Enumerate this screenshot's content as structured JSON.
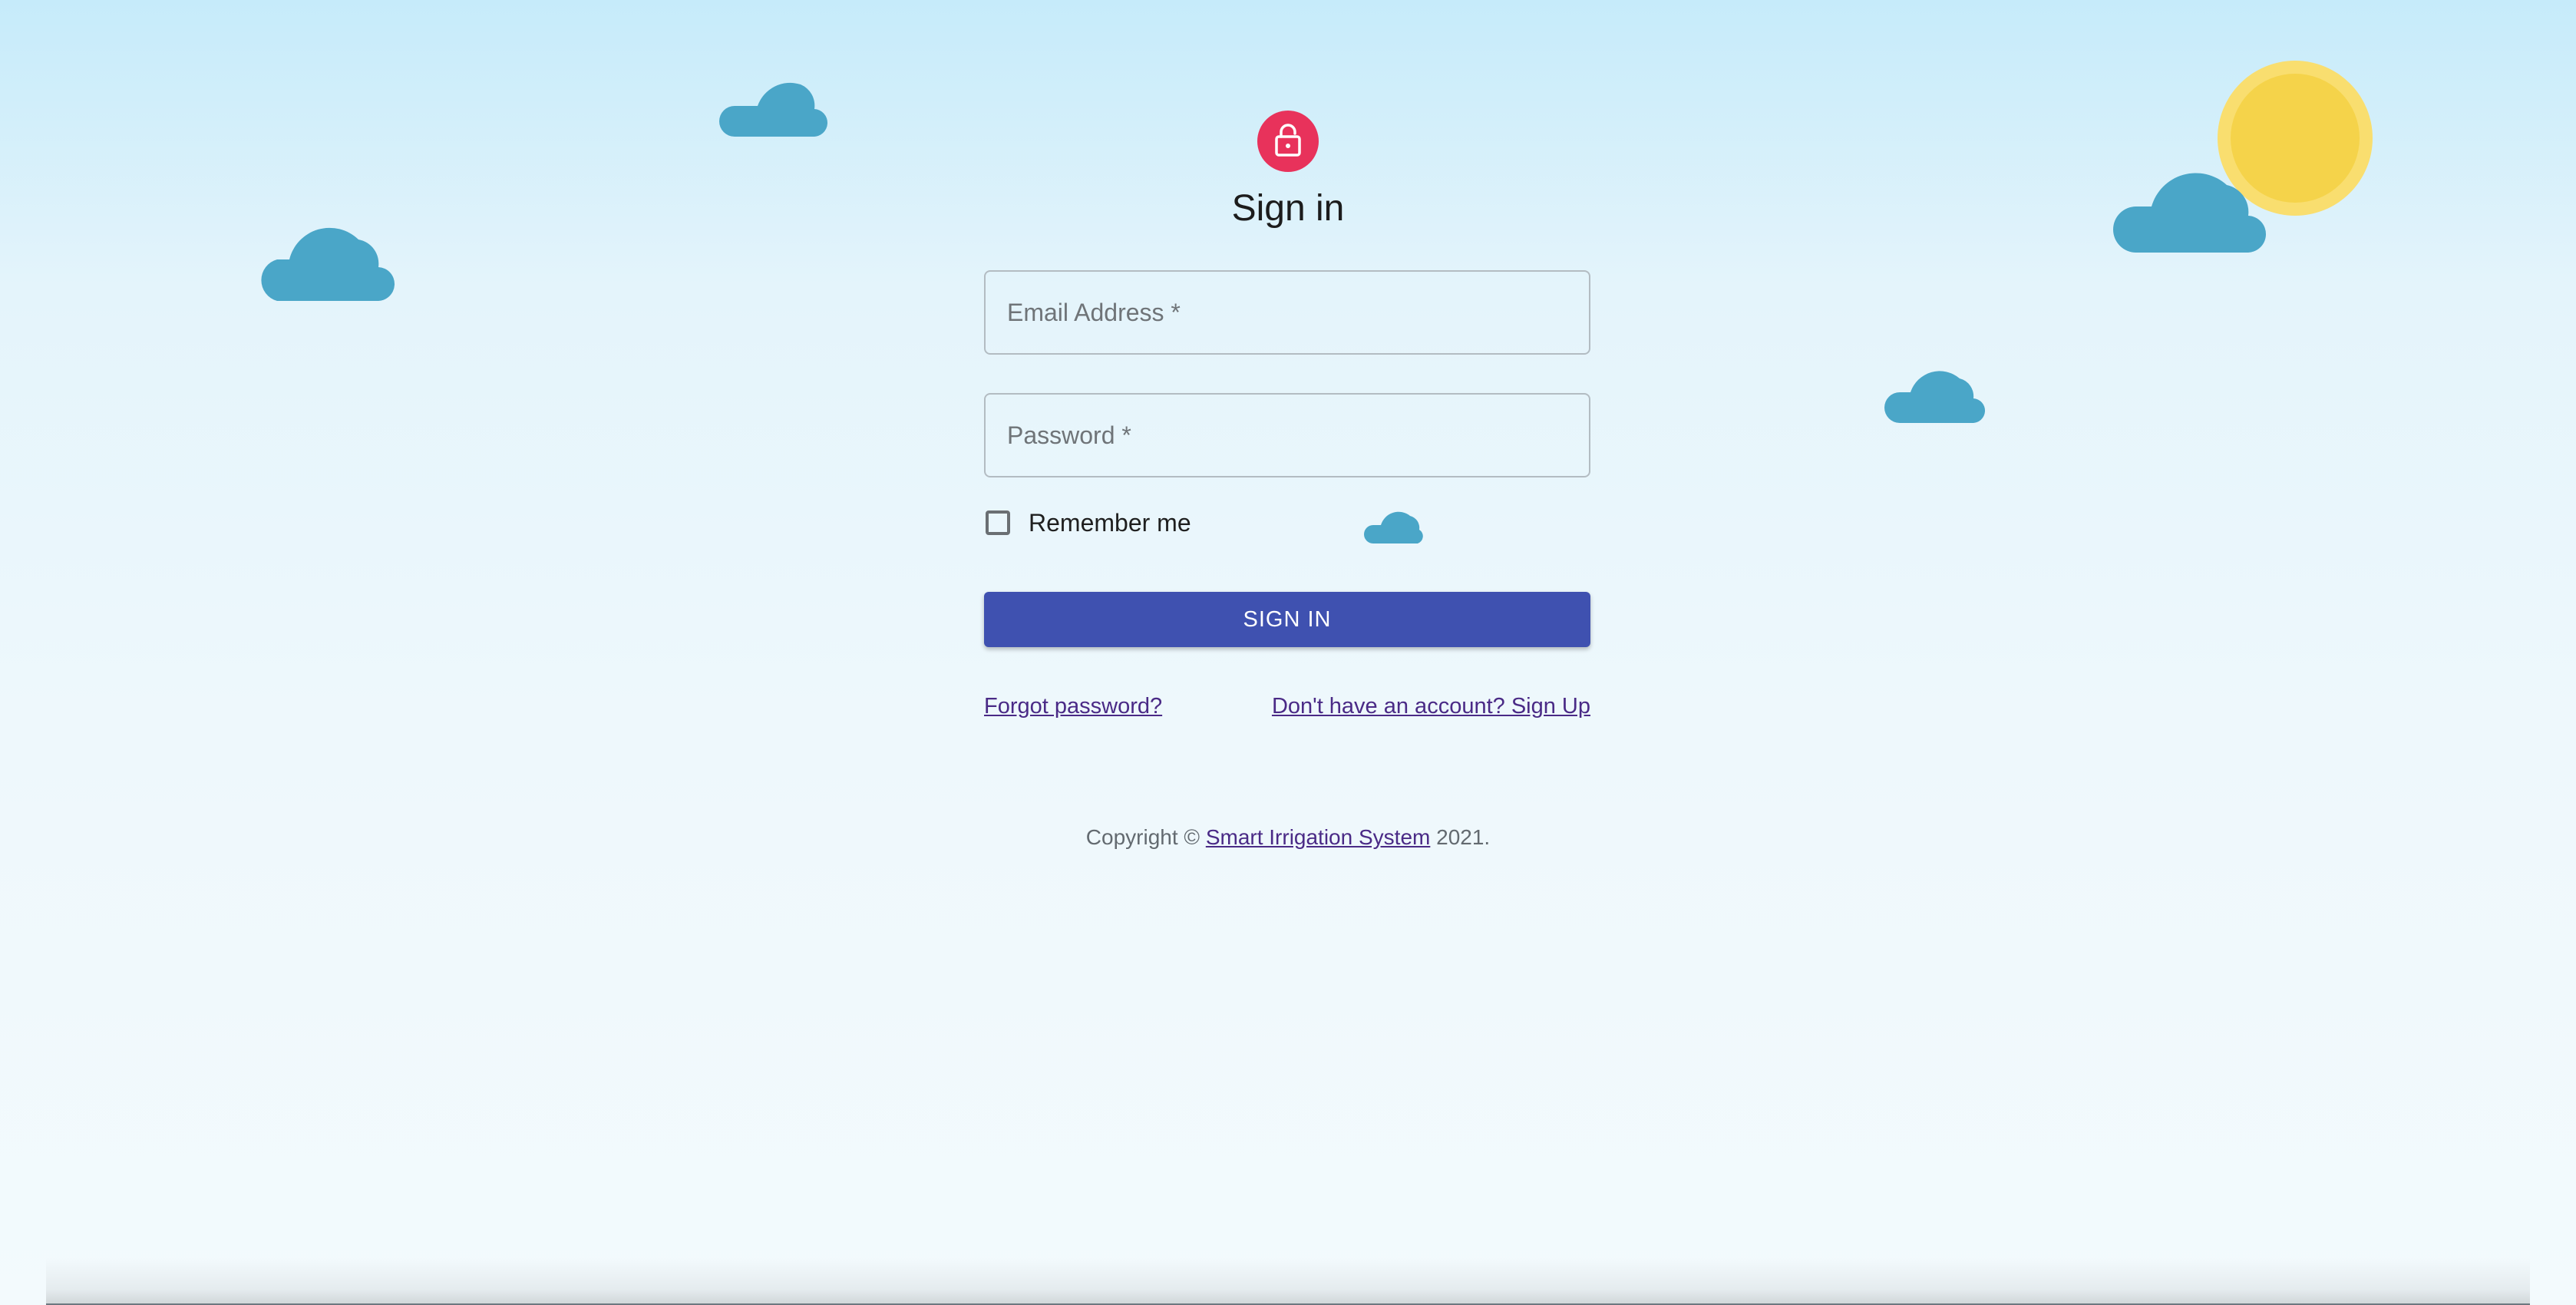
{
  "header": {
    "icon": "lock-icon",
    "icon_color": "#e8325b",
    "title": "Sign in"
  },
  "form": {
    "email_label": "Email Address",
    "email_required_mark": "*",
    "password_label": "Password",
    "password_required_mark": "*",
    "remember_label": "Remember me",
    "submit_label": "SIGN IN",
    "submit_color": "#3f51b0"
  },
  "links": {
    "forgot": "Forgot password?",
    "signup": "Don't have an account? Sign Up"
  },
  "footer": {
    "prefix": "Copyright © ",
    "brand": "Smart Irrigation System",
    "suffix": " 2021."
  },
  "decor": {
    "cloud_color": "#4aa6c8",
    "sun_color": "#f5d34a"
  }
}
